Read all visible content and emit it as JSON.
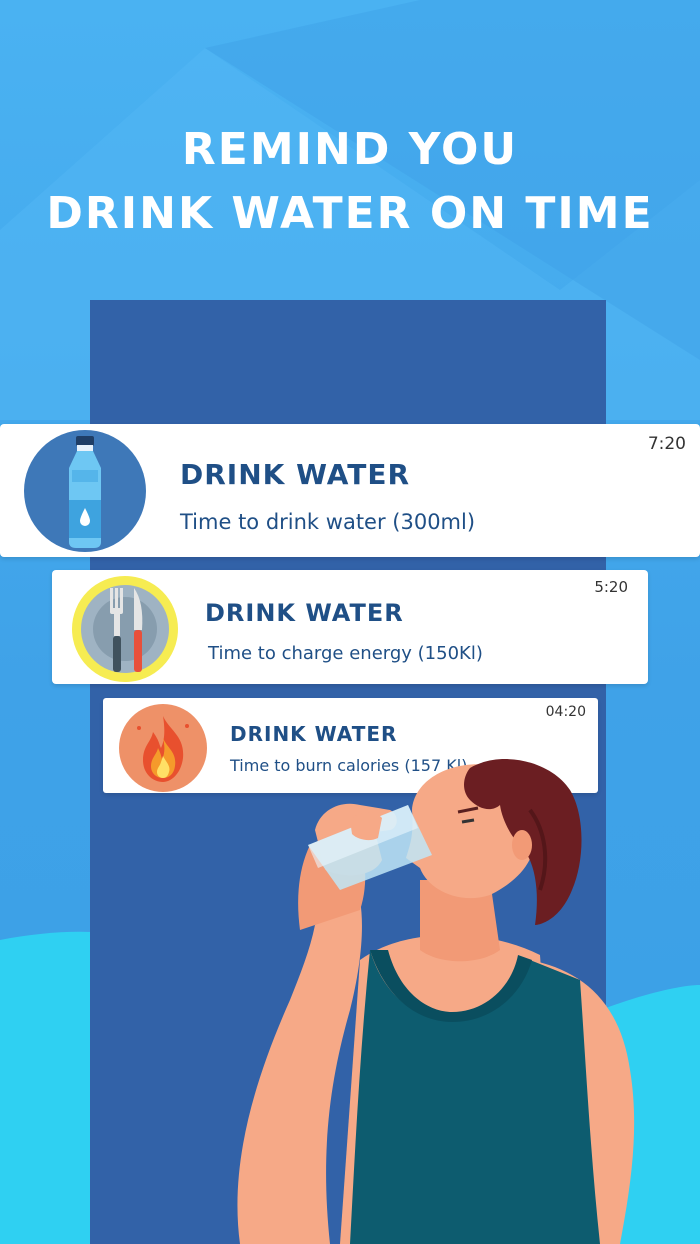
{
  "headline": {
    "line1": "REMIND YOU",
    "line2": "DRINK WATER ON TIME"
  },
  "notifications": [
    {
      "title": "DRINK WATER",
      "message": "Time to drink water (300ml)",
      "time": "7:20",
      "icon": "water-bottle-icon"
    },
    {
      "title": "DRINK WATER",
      "message": "Time to charge energy (150Kl)",
      "time": "5:20",
      "icon": "plate-fork-knife-icon"
    },
    {
      "title": "DRINK WATER",
      "message": "Time to burn calories (157 Kl)",
      "time": "04:20",
      "icon": "fire-icon"
    }
  ],
  "colors": {
    "background": "#4aa8ec",
    "panel": "#3262a8",
    "title_text": "#1f4f86",
    "headline_text": "#ffffff"
  }
}
